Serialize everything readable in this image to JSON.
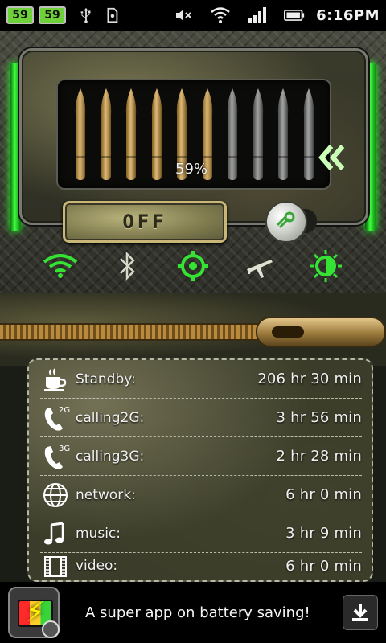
{
  "status_bar": {
    "badge1": "59",
    "badge2": "59",
    "time": "6:16PM",
    "icons": [
      "usb-icon",
      "sd-card-icon",
      "mute-icon",
      "wifi-icon",
      "signal-icon",
      "battery-icon"
    ]
  },
  "battery": {
    "percent_label": "59%",
    "level_fraction": 0.59,
    "gold_color": "#c9922e",
    "gray_color": "#6f7070",
    "off_label": "OFF"
  },
  "toggles": [
    {
      "name": "wifi-toggle",
      "icon": "wifi-icon",
      "active": true
    },
    {
      "name": "bluetooth-toggle",
      "icon": "bluetooth-icon",
      "active": false
    },
    {
      "name": "gps-toggle",
      "icon": "target-icon",
      "active": true
    },
    {
      "name": "airplane-toggle",
      "icon": "airplane-icon",
      "active": false
    },
    {
      "name": "brightness-toggle",
      "icon": "brightness-icon",
      "active": true
    }
  ],
  "stats": [
    {
      "icon": "coffee-icon",
      "label": "Standby:",
      "value": "206 hr  30 min"
    },
    {
      "icon": "phone-2g-icon",
      "label": "calling2G:",
      "value": "3 hr  56 min"
    },
    {
      "icon": "phone-3g-icon",
      "label": "calling3G:",
      "value": "2 hr  28 min"
    },
    {
      "icon": "globe-icon",
      "label": "network:",
      "value": "6 hr  0 min"
    },
    {
      "icon": "music-note-icon",
      "label": "music:",
      "value": "3 hr  9 min"
    },
    {
      "icon": "film-icon",
      "label": "video:",
      "value": "6 hr  0 min"
    }
  ],
  "ad": {
    "text": "A super app on battery saving!"
  },
  "phone_badges": {
    "2g": "2G",
    "3g": "3G"
  }
}
